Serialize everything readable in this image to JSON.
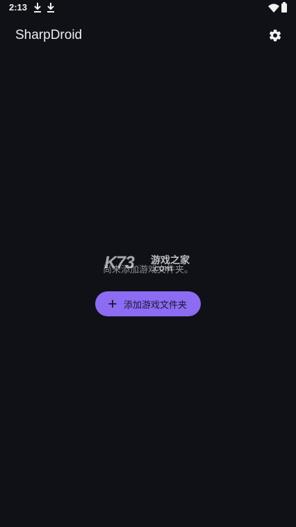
{
  "status_bar": {
    "time": "2:13",
    "icons": [
      "download-icon",
      "download-icon",
      "wifi-icon",
      "battery-icon"
    ]
  },
  "app_bar": {
    "title": "SharpDroid",
    "settings_icon": "gear-icon"
  },
  "empty_state": {
    "message": "尚未添加游戏文件夹。",
    "add_button": {
      "icon": "plus-icon",
      "label": "添加游戏文件夹"
    }
  },
  "watermark": {
    "brand": "K73",
    "text_cn": "游戏之家",
    "text_com": ".com"
  },
  "colors": {
    "background": "#0f1117",
    "accent": "#8b6cf2",
    "text_primary": "#ececf2",
    "text_secondary": "#8d8f98"
  }
}
